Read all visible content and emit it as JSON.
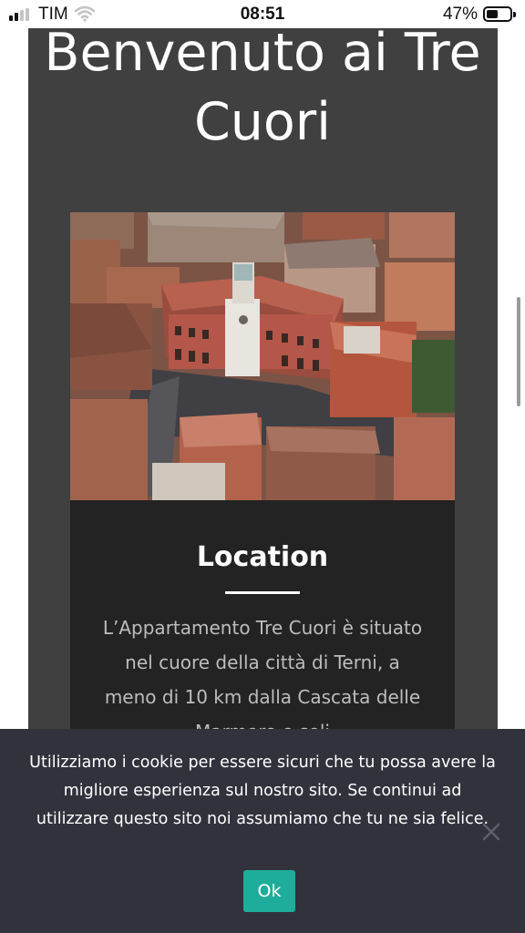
{
  "status_bar": {
    "carrier": "TIM",
    "time": "08:51",
    "battery_percent": "47%",
    "battery_level": 0.47,
    "icons": [
      "signal-icon",
      "wifi-icon",
      "battery-icon"
    ]
  },
  "page": {
    "title": "Benvenuto ai Tre Cuori",
    "hero_image": "aerial-city-square-image",
    "location": {
      "title": "Location",
      "text": "L’Appartamento Tre Cuori è situato nel cuore della città di Terni, a meno di 10 km dalla Cascata delle Marmore e soli"
    }
  },
  "cookie_banner": {
    "message": "Utilizziamo i cookie per essere sicuri che tu possa avere la migliore esperienza sul nostro sito. Se continui ad utilizzare questo sito noi assumiamo che tu ne sia felice.",
    "ok_label": "Ok",
    "close_icon": "close-icon"
  },
  "colors": {
    "panel": "#404040",
    "card": "#232323",
    "banner": "#32323d",
    "accent": "#1fad9b"
  }
}
